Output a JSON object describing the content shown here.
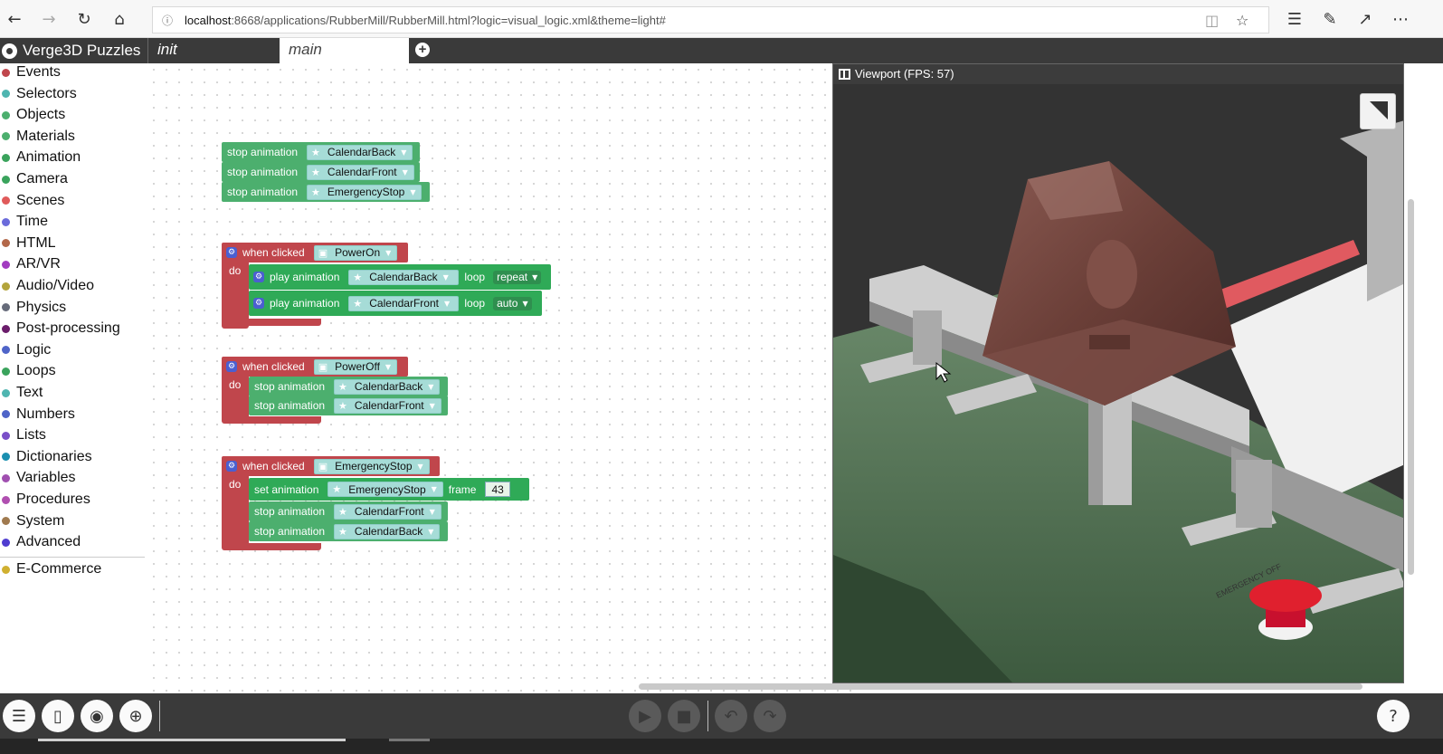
{
  "browser": {
    "url_host": "localhost",
    "url_rest": ":8668/applications/RubberMill/RubberMill.html?logic=visual_logic.xml&theme=light#"
  },
  "app": {
    "title": "Verge3D Puzzles",
    "tabs": [
      {
        "label": "init"
      },
      {
        "label": "main"
      }
    ]
  },
  "toolbox": {
    "categories": [
      {
        "label": "Events",
        "color": "#c0464c"
      },
      {
        "label": "Selectors",
        "color": "#4fb5b0"
      },
      {
        "label": "Objects",
        "color": "#4caf6e"
      },
      {
        "label": "Materials",
        "color": "#4caf6e"
      },
      {
        "label": "Animation",
        "color": "#3aa35c"
      },
      {
        "label": "Camera",
        "color": "#3aa35c"
      },
      {
        "label": "Scenes",
        "color": "#e05a5a"
      },
      {
        "label": "Time",
        "color": "#6b6bdb"
      },
      {
        "label": "HTML",
        "color": "#b3684a"
      },
      {
        "label": "AR/VR",
        "color": "#a23cc0"
      },
      {
        "label": "Audio/Video",
        "color": "#b3a43c"
      },
      {
        "label": "Physics",
        "color": "#666b7a"
      },
      {
        "label": "Post-processing",
        "color": "#6b1d6b"
      },
      {
        "label": "Logic",
        "color": "#4f64c8"
      },
      {
        "label": "Loops",
        "color": "#3aa35c"
      },
      {
        "label": "Text",
        "color": "#4fb5b0"
      },
      {
        "label": "Numbers",
        "color": "#4f64c8"
      },
      {
        "label": "Lists",
        "color": "#7a4fc8"
      },
      {
        "label": "Dictionaries",
        "color": "#1a8fb0"
      },
      {
        "label": "Variables",
        "color": "#a04fb0"
      },
      {
        "label": "Procedures",
        "color": "#b04fb0"
      },
      {
        "label": "System",
        "color": "#a07a4f"
      },
      {
        "label": "Advanced",
        "color": "#4f3cd0"
      },
      {
        "label": "E-Commerce",
        "color": "#d0b030"
      }
    ]
  },
  "blocks": {
    "stop_anim": "stop animation",
    "play_anim": "play animation",
    "set_anim": "set animation",
    "when_clicked": "when clicked",
    "do": "do",
    "loop": "loop",
    "frame": "frame",
    "group1": [
      "CalendarBack",
      "CalendarFront",
      "EmergencyStop"
    ],
    "powon": {
      "object": "PowerOn",
      "play1": "CalendarBack",
      "loop1": "repeat",
      "play2": "CalendarFront",
      "loop2": "auto"
    },
    "powoff": {
      "object": "PowerOff",
      "stop1": "CalendarBack",
      "stop2": "CalendarFront"
    },
    "emergency": {
      "object": "EmergencyStop",
      "set_target": "EmergencyStop",
      "frame_value": "43",
      "stop1": "CalendarFront",
      "stop2": "CalendarBack"
    }
  },
  "viewport": {
    "title": "Viewport (FPS: 57)",
    "button_label": "EMERGENCY OFF"
  },
  "colors": {
    "event_block": "#c0464c",
    "animation_block": "#4caf6e",
    "selector_chip": "#a6dcd7",
    "toolbar_bg": "#3a3a3a"
  },
  "icons": {
    "back": "arrow-left-icon",
    "forward": "arrow-right-icon",
    "reload": "reload-icon",
    "home": "home-icon",
    "help": "help-icon"
  }
}
